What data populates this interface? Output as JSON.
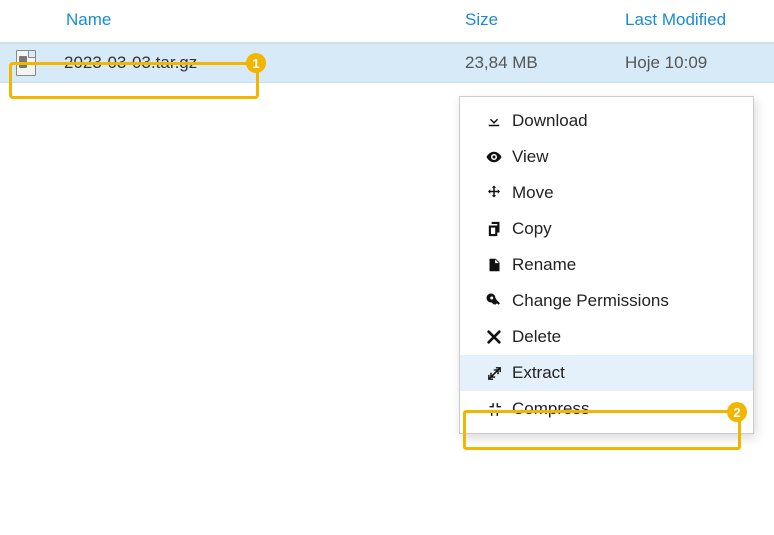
{
  "columns": {
    "name": "Name",
    "size": "Size",
    "modified": "Last Modified"
  },
  "file": {
    "name": "2023-03-03.tar.gz",
    "size": "23,84 MB",
    "modified": "Hoje 10:09"
  },
  "badges": {
    "one": "1",
    "two": "2"
  },
  "menu": {
    "download": "Download",
    "view": "View",
    "move": "Move",
    "copy": "Copy",
    "rename": "Rename",
    "permissions": "Change Permissions",
    "delete": "Delete",
    "extract": "Extract",
    "compress": "Compress"
  }
}
